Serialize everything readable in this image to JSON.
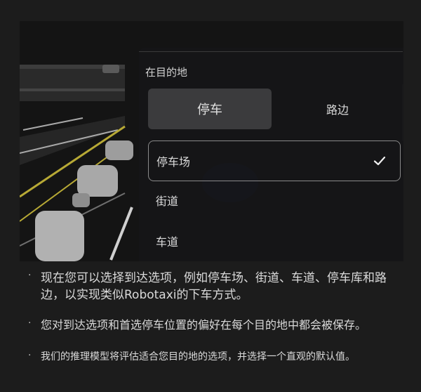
{
  "panel": {
    "destination_label": "在目的地",
    "segments": [
      {
        "label": "停车",
        "active": true
      },
      {
        "label": "路边",
        "active": false
      }
    ],
    "options": [
      {
        "label": "停车场",
        "selected": true
      },
      {
        "label": "街道",
        "selected": false
      },
      {
        "label": "车道",
        "selected": false
      }
    ],
    "check_icon": "checkmark-icon"
  },
  "notes": [
    "现在您可以选择到达选项，例如停车场、街道、车道、停车库和路边，以实现类似Robotaxi的下车方式。",
    "您对到达选项和首选停车位置的偏好在每个目的地中都会被保存。",
    "我们的推理模型将评估适合您目的地的选项，并选择一个直观的默认值。"
  ],
  "colors": {
    "background": "#1c1c1c",
    "panel": "#161618",
    "segment_active": "#3b3b3d",
    "selected_border": "#8a8a8a",
    "lane_line": "#b7a935"
  }
}
